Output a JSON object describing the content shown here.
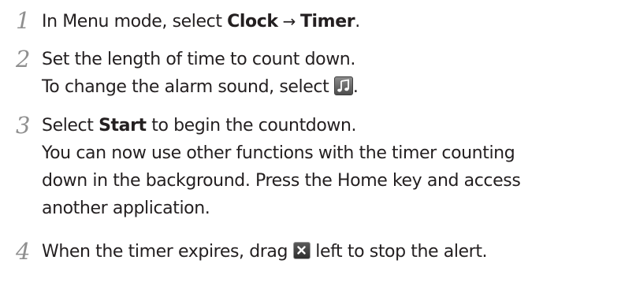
{
  "steps": [
    {
      "number": "1",
      "lines": [
        {
          "parts": [
            {
              "text": "In Menu mode, select ",
              "style": "normal"
            },
            {
              "text": "Clock",
              "style": "bold"
            },
            {
              "text": " → ",
              "style": "arrow"
            },
            {
              "text": "Timer",
              "style": "bold"
            },
            {
              "text": ".",
              "style": "normal"
            }
          ]
        }
      ]
    },
    {
      "number": "2",
      "lines": [
        {
          "parts": [
            {
              "text": "Set the length of time to count down.",
              "style": "normal"
            }
          ]
        },
        {
          "parts": [
            {
              "text": "To change the alarm sound, select ",
              "style": "normal"
            },
            {
              "icon": "music-note-icon",
              "style": "icon"
            },
            {
              "text": ".",
              "style": "normal"
            }
          ]
        }
      ]
    },
    {
      "number": "3",
      "lines": [
        {
          "parts": [
            {
              "text": "Select ",
              "style": "normal"
            },
            {
              "text": "Start",
              "style": "bold"
            },
            {
              "text": " to begin the countdown.",
              "style": "normal"
            }
          ]
        },
        {
          "parts": [
            {
              "text": "You can now use other functions with the timer counting",
              "style": "normal"
            }
          ]
        },
        {
          "parts": [
            {
              "text": "down in the background. Press the Home key and access",
              "style": "normal"
            }
          ]
        },
        {
          "parts": [
            {
              "text": "another application.",
              "style": "normal"
            }
          ]
        }
      ]
    },
    {
      "number": "4",
      "lines": [
        {
          "parts": [
            {
              "text": "When the timer expires, drag ",
              "style": "normal"
            },
            {
              "icon": "close-x-icon",
              "style": "icon"
            },
            {
              "text": " left to stop the alert.",
              "style": "normal"
            }
          ]
        }
      ]
    }
  ],
  "colors": {
    "text": "#231f20",
    "step_number": "#8f8f8f"
  }
}
